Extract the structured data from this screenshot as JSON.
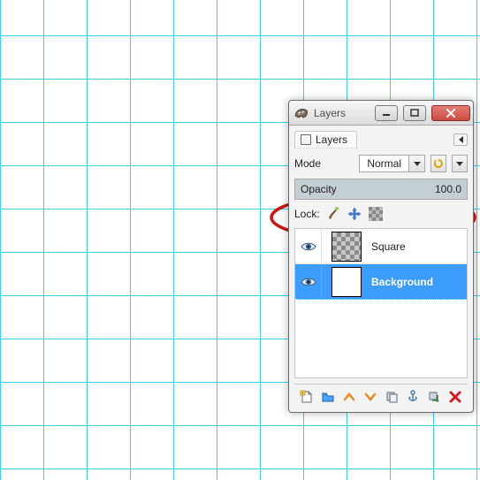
{
  "titlebar": {
    "title": "Layers"
  },
  "tab": {
    "label": "Layers"
  },
  "mode": {
    "label": "Mode",
    "value": "Normal"
  },
  "opacity": {
    "label": "Opacity",
    "value": "100.0"
  },
  "lock": {
    "label": "Lock:"
  },
  "layers": [
    {
      "name": "Square",
      "selected": false,
      "thumb": "square"
    },
    {
      "name": "Background",
      "selected": true,
      "thumb": "white"
    }
  ],
  "icons": {
    "brush": "brush-icon",
    "move": "move-icon",
    "alpha": "alpha-icon"
  }
}
